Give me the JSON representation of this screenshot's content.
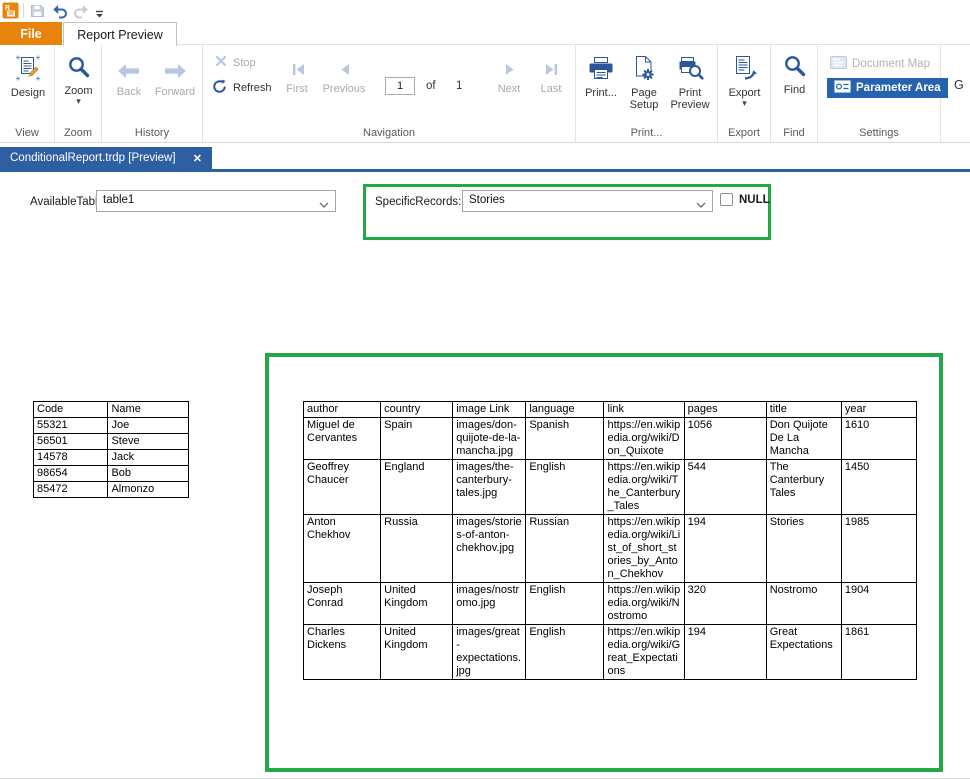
{
  "colors": {
    "brand_orange": "#e8830c",
    "doc_tab_blue": "#2e5fa3",
    "selected_button_blue": "#2563af",
    "highlight_green": "#22a844",
    "ribbon_icon_blue": "#2b579a",
    "disabled_icon": "#b9c6e2"
  },
  "icons": {
    "close": "✕",
    "caret": "▾"
  },
  "tabs": {
    "file": "File",
    "report_preview": "Report Preview"
  },
  "ribbon": {
    "design": "Design",
    "zoom": "Zoom",
    "back": "Back",
    "forward": "Forward",
    "stop": "Stop",
    "refresh": "Refresh",
    "first": "First",
    "previous": "Previous",
    "page_value": "1",
    "of": "of",
    "page_count": "1",
    "next": "Next",
    "last": "Last",
    "print": "Print...",
    "page_setup": "Page Setup",
    "print_preview": "Print Preview",
    "export": "Export",
    "find": "Find",
    "document_map": "Document Map",
    "parameter_area": "Parameter Area",
    "overflow_partial": "G",
    "groups": {
      "view": "View",
      "zoom": "Zoom",
      "history": "History",
      "navigation": "Navigation",
      "print": "Print...",
      "export": "Export",
      "find": "Find",
      "settings": "Settings"
    }
  },
  "document_tab": {
    "title": "ConditionalReport.trdp [Preview]"
  },
  "parameters": {
    "available_table": {
      "label": "AvailableTable:",
      "value": "table1"
    },
    "specific_records": {
      "label": "SpecificRecords:",
      "value": "Stories",
      "null_label": "NULL",
      "null_checked": false
    }
  },
  "left_table": {
    "headers": [
      "Code",
      "Name"
    ],
    "rows": [
      [
        "55321",
        "Joe"
      ],
      [
        "56501",
        "Steve"
      ],
      [
        "14578",
        "Jack"
      ],
      [
        "98654",
        "Bob"
      ],
      [
        "85472",
        "Almonzo"
      ]
    ]
  },
  "books_table": {
    "headers": [
      "author",
      "country",
      "image Link",
      "language",
      "link",
      "pages",
      "title",
      "year"
    ],
    "rows": [
      [
        "Miguel de Cervantes",
        "Spain",
        "images/don-quijote-de-la-mancha.jpg",
        "Spanish",
        "https://en.wikipedia.org/wiki/Don_Quixote",
        "1056",
        "Don Quijote De La Mancha",
        "1610"
      ],
      [
        "Geoffrey Chaucer",
        "England",
        "images/the-canterbury-tales.jpg",
        "English",
        "https://en.wikipedia.org/wiki/The_Canterbury_Tales",
        "544",
        "The Canterbury Tales",
        "1450"
      ],
      [
        "Anton Chekhov",
        "Russia",
        "images/stories-of-anton-chekhov.jpg",
        "Russian",
        "https://en.wikipedia.org/wiki/List_of_short_stories_by_Anton_Chekhov",
        "194",
        "Stories",
        "1985"
      ],
      [
        "Joseph Conrad",
        "United Kingdom",
        "images/nostromo.jpg",
        "English",
        "https://en.wikipedia.org/wiki/Nostromo",
        "320",
        "Nostromo",
        "1904"
      ],
      [
        "Charles Dickens",
        "United Kingdom",
        "images/great-expectations.jpg",
        "English",
        "https://en.wikipedia.org/wiki/Great_Expectations",
        "194",
        "Great Expectations",
        "1861"
      ]
    ]
  }
}
